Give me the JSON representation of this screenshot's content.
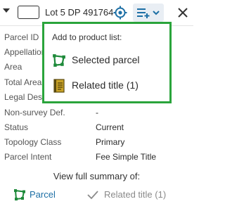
{
  "header": {
    "title": "Lot 5 DP 491764"
  },
  "properties": [
    {
      "label": "Parcel ID",
      "value": ""
    },
    {
      "label": "Appellation",
      "value": ""
    },
    {
      "label": "Area",
      "value": ""
    },
    {
      "label": "Total Area",
      "value": ""
    },
    {
      "label": "Legal Desc",
      "value": ""
    },
    {
      "label": "Non-survey Def.",
      "value": "-"
    },
    {
      "label": "Status",
      "value": "Current"
    },
    {
      "label": "Topology Class",
      "value": "Primary"
    },
    {
      "label": "Parcel Intent",
      "value": "Fee Simple Title"
    }
  ],
  "summary": {
    "heading": "View full summary of:",
    "parcel_label": "Parcel",
    "related_title_label": "Related title (1)"
  },
  "popup": {
    "title": "Add to product list:",
    "items": [
      {
        "label": "Selected parcel",
        "icon": "parcel-icon"
      },
      {
        "label": "Related title (1)",
        "icon": "title-document-icon"
      }
    ]
  },
  "colors": {
    "popup_border": "#2aa43b",
    "link_blue": "#1d6fa5",
    "parcel_icon": "#1e8a3a",
    "title_icon": "#c9a227"
  }
}
